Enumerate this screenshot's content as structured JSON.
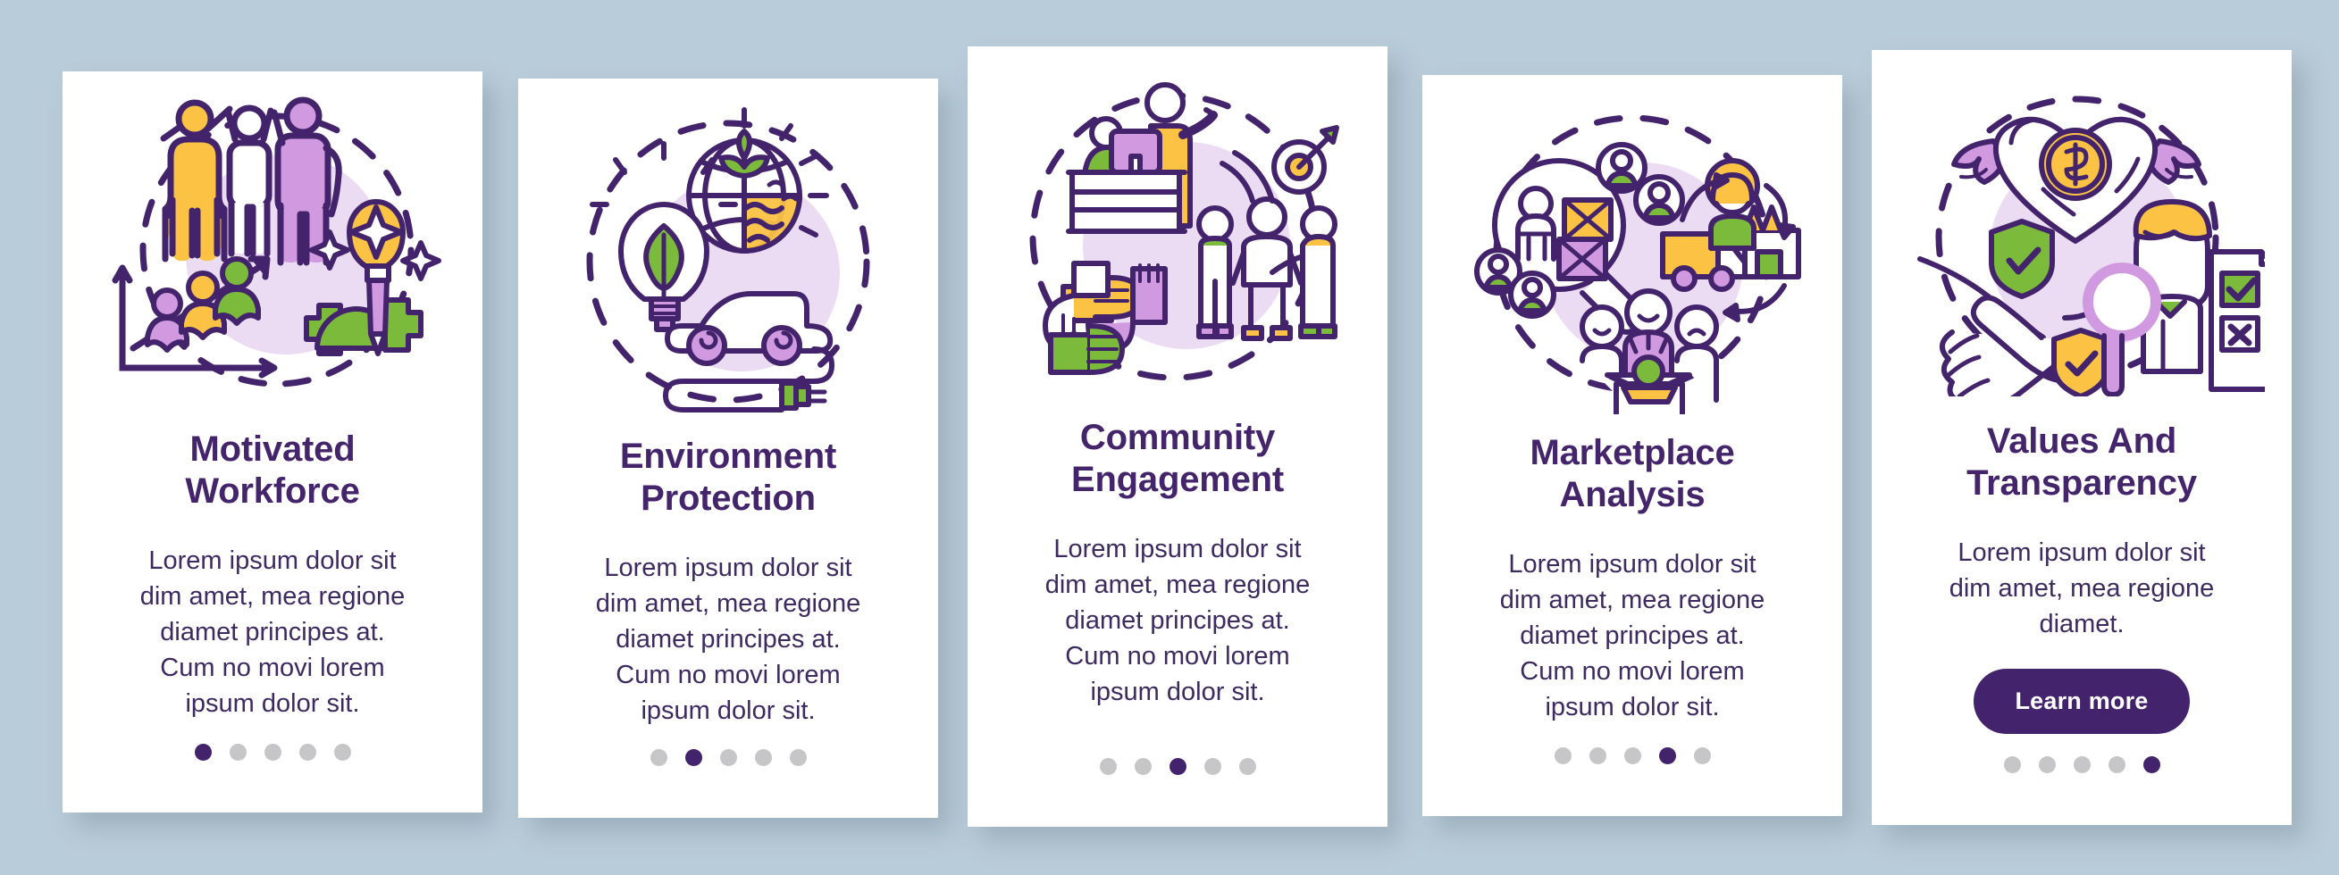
{
  "theme": {
    "page_background": "#b9ccd9",
    "card_background": "#ffffff",
    "accent_purple": "#43246c",
    "title_color": "#44246b",
    "body_color": "#3d2a60",
    "dot_inactive": "#c6c6c9",
    "illustration_green": "#7cba3c",
    "illustration_yellow": "#fbc244",
    "illustration_violet": "#d19ae0",
    "illustration_blob": "#ecdcf3"
  },
  "screens": [
    {
      "index": 1,
      "title": "Motivated\nWorkforce",
      "body": "Lorem ipsum dolor sit dim amet, mea regione diamet principes at. Cum no movi lorem ipsum dolor sit.",
      "illustration": "motivated-workforce-illustration",
      "cta": null,
      "dots": {
        "total": 5,
        "active": 1
      }
    },
    {
      "index": 2,
      "title": "Environment\nProtection",
      "body": "Lorem ipsum dolor sit dim amet, mea regione diamet principes at. Cum no movi lorem ipsum dolor sit.",
      "illustration": "environment-protection-illustration",
      "cta": null,
      "dots": {
        "total": 5,
        "active": 2
      }
    },
    {
      "index": 3,
      "title": "Community\nEngagement",
      "body": "Lorem ipsum dolor sit dim amet, mea regione diamet principes at. Cum no movi lorem ipsum dolor sit.",
      "illustration": "community-engagement-illustration",
      "cta": null,
      "dots": {
        "total": 5,
        "active": 3
      }
    },
    {
      "index": 4,
      "title": "Marketplace\nAnalysis",
      "body": "Lorem ipsum dolor sit dim amet, mea regione diamet principes at. Cum no movi lorem ipsum dolor sit.",
      "illustration": "marketplace-analysis-illustration",
      "cta": null,
      "dots": {
        "total": 5,
        "active": 4
      }
    },
    {
      "index": 5,
      "title": "Values And\nTransparency",
      "body": "Lorem ipsum dolor sit dim amet, mea regione diamet.",
      "illustration": "values-transparency-illustration",
      "cta": "Learn more",
      "dots": {
        "total": 5,
        "active": 5
      }
    }
  ]
}
